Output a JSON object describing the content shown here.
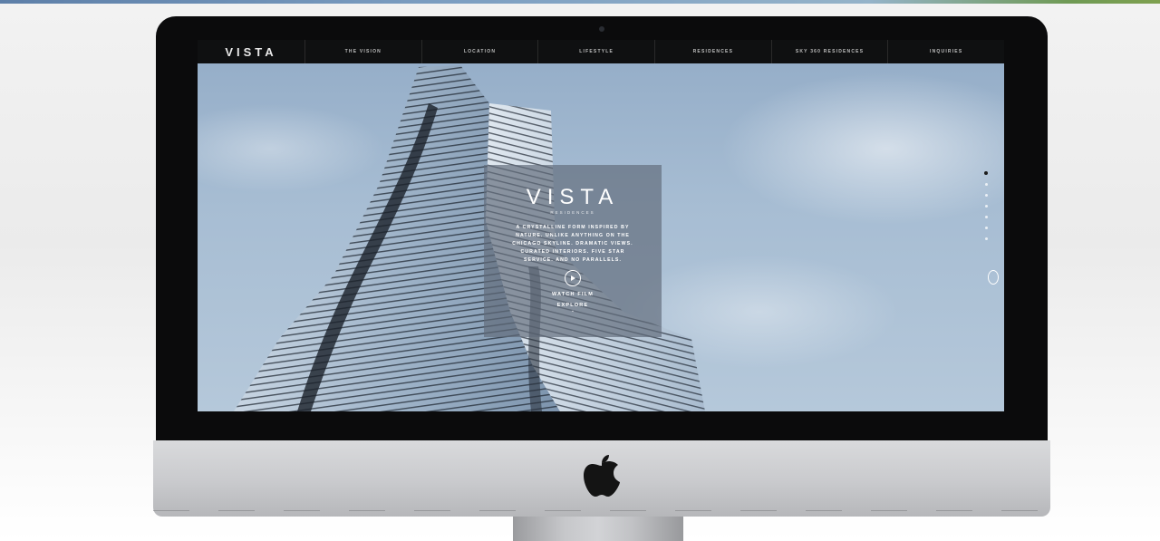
{
  "nav": {
    "logo": "VISTA",
    "items": [
      {
        "label": "THE VISION"
      },
      {
        "label": "LOCATION"
      },
      {
        "label": "LIFESTYLE"
      },
      {
        "label": "RESIDENCES"
      },
      {
        "label": "SKY 360 RESIDENCES"
      },
      {
        "label": "INQUIRIES"
      }
    ]
  },
  "hero": {
    "logo": "VISTA",
    "subtitle": "RESIDENCES",
    "description": "A CRYSTALLINE FORM INSPIRED BY NATURE. UNLIKE ANYTHING ON THE CHICAGO SKYLINE. DRAMATIC VIEWS. CURATED INTERIORS. FIVE STAR SERVICE. AND NO PARALLELS.",
    "watch_film": "WATCH FILM",
    "explore": "EXPLORE"
  },
  "side_nav": {
    "dot_count": 7,
    "active_index": 0
  },
  "colors": {
    "nav_background": "#0f1011",
    "hero_card": "#626c7a",
    "sky": "#a7bdd3",
    "bezel": "#0b0b0c",
    "chin": "#c9cacd"
  }
}
